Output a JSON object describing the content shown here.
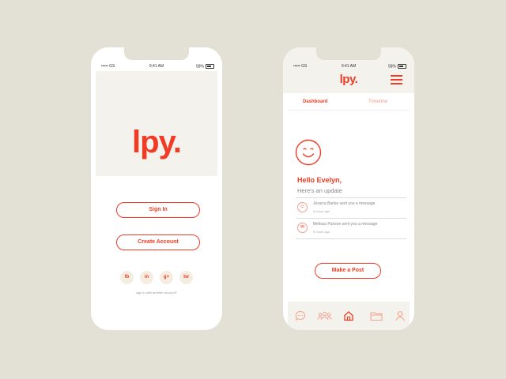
{
  "status_bar": {
    "carrier": "••••• GS",
    "time": "9:41 AM",
    "battery": "58%"
  },
  "login_screen": {
    "logo": "lpy.",
    "sign_in_label": "Sign In",
    "create_account_label": "Create Account",
    "social_buttons": [
      "fb",
      "in",
      "g+",
      "tw"
    ],
    "alt_sign_in_text": "sign in with another account?"
  },
  "dashboard_screen": {
    "logo": "lpy.",
    "tabs": [
      {
        "label": "Dashboard",
        "active": true
      },
      {
        "label": "Timeline",
        "active": false
      }
    ],
    "greeting": "Hello Evelyn,",
    "subtitle": "Here's an update",
    "notifications": [
      {
        "icon": "smiley-icon",
        "text": "Jessica Banke sent you a message",
        "time": "5 hours ago"
      },
      {
        "icon": "mail-icon",
        "text": "Melissa Panson sent you a message",
        "time": "5 hours ago"
      }
    ],
    "make_post_label": "Make a Post",
    "bottom_nav": [
      "chat-icon",
      "group-icon",
      "home-icon",
      "folder-icon",
      "profile-icon"
    ],
    "active_nav": "home-icon"
  },
  "colors": {
    "accent": "#f03c24",
    "background": "#e3e0d6",
    "panel": "#f3f2ec"
  }
}
